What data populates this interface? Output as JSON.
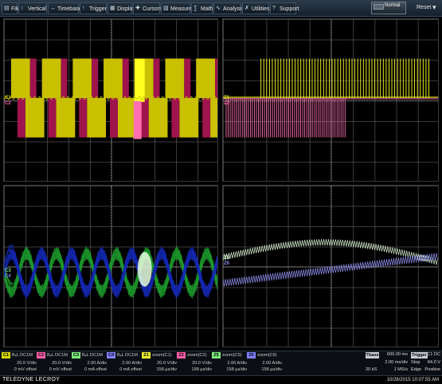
{
  "menubar": {
    "items": [
      {
        "label": "File",
        "icon": "file-icon"
      },
      {
        "label": "Vertical",
        "icon": "vertical-icon"
      },
      {
        "label": "Timebase",
        "icon": "timebase-icon"
      },
      {
        "label": "Trigger",
        "icon": "trigger-icon"
      },
      {
        "label": "Display",
        "icon": "display-icon"
      },
      {
        "label": "Cursors",
        "icon": "cursors-icon"
      },
      {
        "label": "Measure",
        "icon": "measure-icon"
      },
      {
        "label": "Math",
        "icon": "math-icon"
      },
      {
        "label": "Analysis",
        "icon": "analysis-icon"
      },
      {
        "label": "Utilities",
        "icon": "utilities-icon"
      },
      {
        "label": "Support",
        "icon": "support-icon"
      }
    ],
    "trigger_mode": "Normal",
    "reset_label": "Reset"
  },
  "grids": {
    "tl": {
      "trace_tags": [
        "C1",
        "C2"
      ]
    },
    "tr": {
      "trace_tags": [
        "Z1",
        "Z2"
      ]
    },
    "bl": {
      "trace_tags": [
        "C3",
        "C4"
      ]
    },
    "br": {
      "trace_tags": [
        "Z5",
        "Z6"
      ]
    }
  },
  "channels": [
    {
      "tag": "C1",
      "color": "#d8d800",
      "coupling": "BₓL DC1M",
      "vdiv": "20.0 V/div",
      "offset": "0 mV offset"
    },
    {
      "tag": "C2",
      "color": "#ff5fa8",
      "coupling": "BₓL DC1M",
      "vdiv": "20.0 V/div",
      "offset": "0 mV offset"
    },
    {
      "tag": "C3",
      "color": "#7ee87e",
      "coupling": "BₓL DC1M",
      "vdiv": "2.00 A/div",
      "offset": "0 mA offset"
    },
    {
      "tag": "C4",
      "color": "#7f80ff",
      "coupling": "BₓL DC1M",
      "vdiv": "2.00 A/div",
      "offset": "0 mA offset"
    },
    {
      "tag": "Z1",
      "color": "#e8e830",
      "coupling": "zoom(C1)",
      "vdiv": "20.0 V/div",
      "offset": "158 µs/div"
    },
    {
      "tag": "Z2",
      "color": "#ff5fa8",
      "coupling": "zoom(C2)",
      "vdiv": "20.0 V/div",
      "offset": "158 µs/div"
    },
    {
      "tag": "Z5",
      "color": "#7ee87e",
      "coupling": "zoom(C5)",
      "vdiv": "2.00 A/div",
      "offset": "158 µs/div"
    },
    {
      "tag": "Z6",
      "color": "#7f80ff",
      "coupling": "zoom(C6)",
      "vdiv": "2.00 A/div",
      "offset": "158 µs/div"
    }
  ],
  "timebase": {
    "label": "Tbase",
    "delay": "600.00 ms",
    "per_div": "2.00 ms/div",
    "samples": "20 kS",
    "rate": "1 MS/s"
  },
  "trigger": {
    "label": "Trigger",
    "source": "C1 DC",
    "mode": "Stop",
    "level": "64.0 V",
    "type": "Edge",
    "slope": "Positive"
  },
  "footer": {
    "brand": "TELEDYNE LECROY",
    "datetime": "10/28/2015 10:07:55 AM"
  },
  "colors": {
    "c1": "#c8c000",
    "c2": "#a0144e",
    "c3": "#1c9a2c",
    "c4": "#1428b4",
    "z1": "#ffff20",
    "z2": "#ff70b0",
    "z5": "#d8f0d0",
    "z6": "#9090f0"
  }
}
